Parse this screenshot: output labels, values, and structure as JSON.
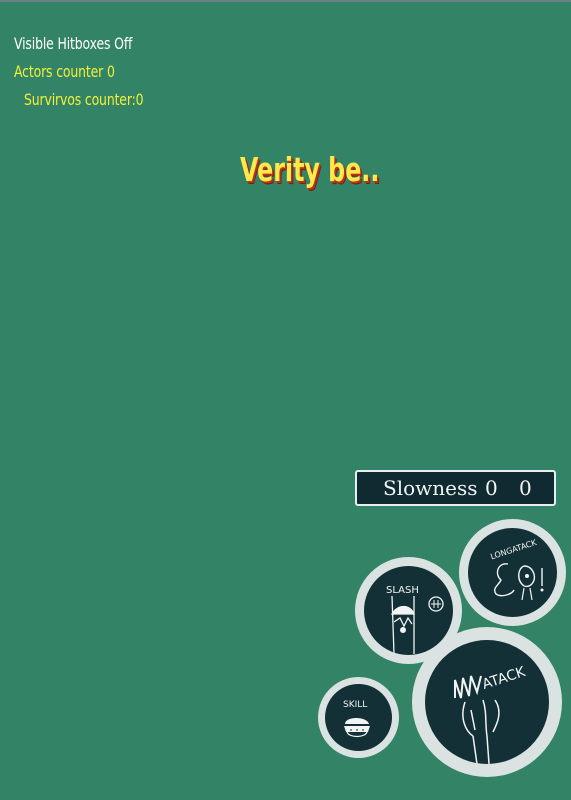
{
  "hud": {
    "hitboxes": "Visible Hitboxes Off",
    "actors": "Actors counter 0",
    "survivors": "Survirvos counter:0"
  },
  "title": "Verity be..",
  "status": {
    "label": "Slowness",
    "value1": "0",
    "value2": "0"
  },
  "buttons": {
    "long_attack": "LONGATACK",
    "slash": "SLASH",
    "attack": "ATACK",
    "skill": "SKILL"
  },
  "colors": {
    "background": "#338466",
    "hud_white": "#ffffff",
    "hud_yellow": "#f3ef3a",
    "title_fill": "#ffe94a",
    "title_shadow": "#b4341b",
    "button_ring": "#dbe3e2",
    "button_fill": "#133036"
  }
}
